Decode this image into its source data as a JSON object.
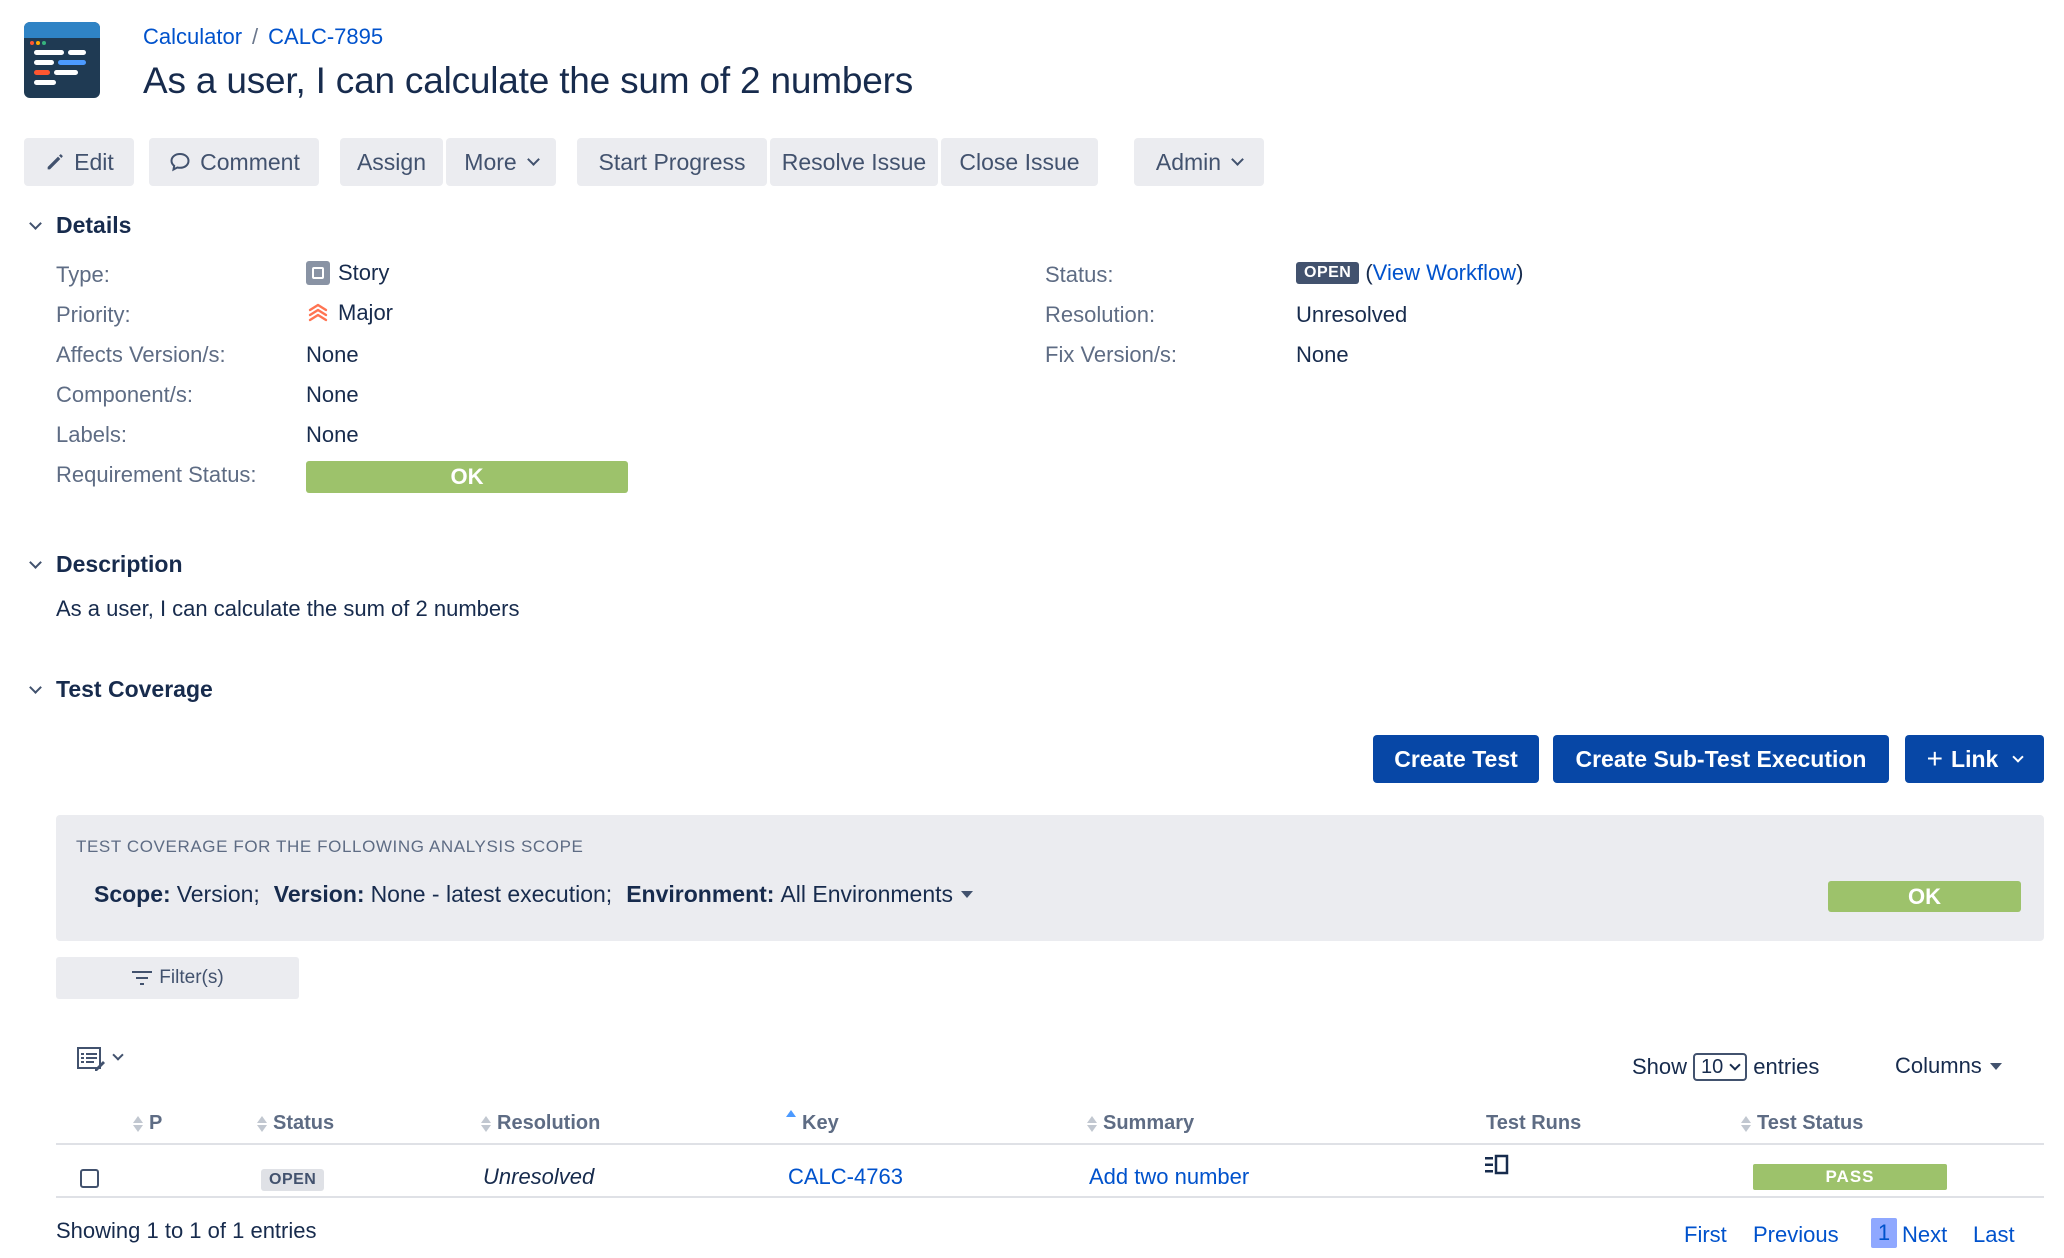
{
  "breadcrumbs": {
    "project": "Calculator",
    "separator": "/",
    "issue_key": "CALC-7895"
  },
  "issue": {
    "title": "As a user, I can calculate the sum of 2 numbers"
  },
  "toolbar": {
    "edit": "Edit",
    "comment": "Comment",
    "assign": "Assign",
    "more": "More",
    "start_progress": "Start Progress",
    "resolve_issue": "Resolve Issue",
    "close_issue": "Close Issue",
    "admin": "Admin"
  },
  "details": {
    "heading": "Details",
    "type_label": "Type:",
    "type_value": "Story",
    "priority_label": "Priority:",
    "priority_value": "Major",
    "affects_label": "Affects Version/s:",
    "affects_value": "None",
    "components_label": "Component/s:",
    "components_value": "None",
    "labels_label": "Labels:",
    "labels_value": "None",
    "req_status_label": "Requirement Status:",
    "req_status_value": "OK",
    "status_label": "Status:",
    "status_value": "OPEN",
    "view_workflow_open": "(",
    "view_workflow": "View Workflow",
    "view_workflow_close": ")",
    "resolution_label": "Resolution:",
    "resolution_value": "Unresolved",
    "fix_label": "Fix Version/s:",
    "fix_value": "None"
  },
  "description": {
    "heading": "Description",
    "text": "As a user, I can calculate the sum of 2 numbers"
  },
  "coverage": {
    "heading": "Test Coverage",
    "create_test": "Create Test",
    "create_sub_exec": "Create Sub-Test Execution",
    "link_plus": "+",
    "link": "Link",
    "scope_caption": "TEST COVERAGE FOR THE FOLLOWING ANALYSIS SCOPE",
    "scope_label": "Scope:",
    "scope_value": "Version;",
    "version_label": "Version:",
    "version_value": "None - latest execution;",
    "env_label": "Environment:",
    "env_value": "All Environments",
    "status": "OK",
    "filter": "Filter(s)"
  },
  "table": {
    "show": "Show",
    "page_size": "10",
    "entries": "entries",
    "columns": "Columns",
    "headers": {
      "p": "P",
      "status": "Status",
      "resolution": "Resolution",
      "key": "Key",
      "summary": "Summary",
      "test_runs": "Test Runs",
      "test_status": "Test Status"
    },
    "rows": [
      {
        "status": "OPEN",
        "resolution": "Unresolved",
        "key": "CALC-4763",
        "summary": "Add two number",
        "test_status": "PASS"
      }
    ],
    "info": "Showing 1 to 1 of 1 entries",
    "pager": {
      "first": "First",
      "previous": "Previous",
      "current": "1",
      "next": "Next",
      "last": "Last"
    }
  },
  "colors": {
    "primary": "#0747a6",
    "link": "#0052cc",
    "ok_green": "#9dc26b",
    "text": "#172b4d",
    "muted": "#5e6c84",
    "button_bg": "#ebecf0"
  }
}
